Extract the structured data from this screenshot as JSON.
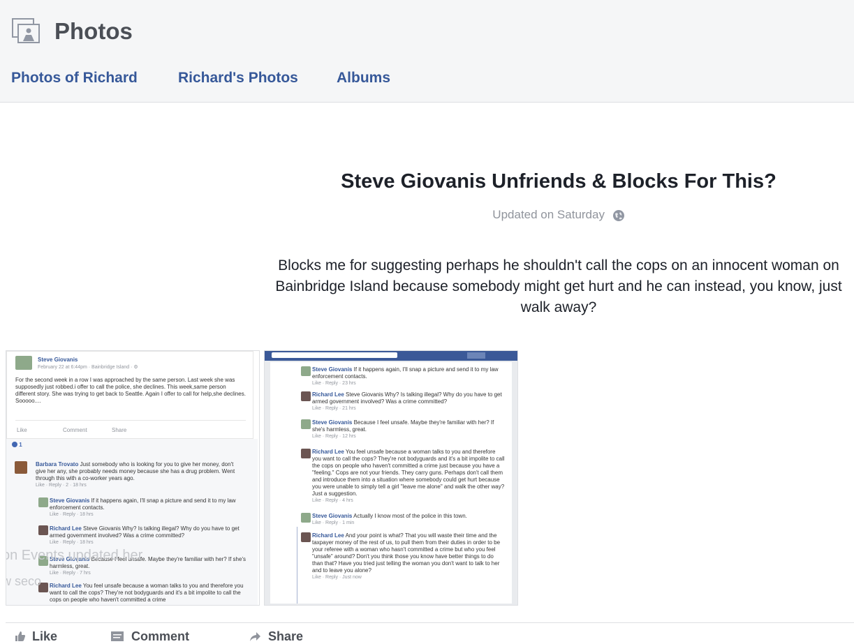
{
  "header": {
    "title": "Photos",
    "icon": "photos-icon",
    "tabs": [
      {
        "label": "Photos of Richard"
      },
      {
        "label": "Richard's Photos"
      },
      {
        "label": "Albums"
      }
    ]
  },
  "album": {
    "title": "Steve Giovanis Unfriends & Blocks For This?",
    "updated": "Updated on Saturday",
    "privacy_icon": "globe-icon",
    "description": "Blocks me for suggesting perhaps he shouldn't call the cops on an innocent woman on Bainbridge Island because somebody might get hurt and he can instead, you know, just walk away?"
  },
  "photo1": {
    "author": "Steve Giovanis",
    "meta": "February 22 at 6:44pm · Bainbridge Island · ⚙",
    "post_text": "For the second week in a row I was approached by the same person. Last week she was supposedly just robbed.i offer to call the police, she declines. This week,same person different story. She was trying to get back to Seattle. Again I offer to call for help,she declines. Sooooo....",
    "actions": [
      "Like",
      "Comment",
      "Share"
    ],
    "reaction_count": "1",
    "comments": [
      {
        "name": "Barbara Trovato",
        "text": "Just somebody who is looking for you to give her money, don't give her any, she probably needs money because she has a drug problem. Went through this with a co-worker years ago.",
        "meta": "Like · Reply · 2 · 18 hrs"
      },
      {
        "name": "Steve Giovanis",
        "text": "If it happens again, I'll snap a picture and send it to my law enforcement contacts.",
        "meta": "Like · Reply · 18 hrs"
      },
      {
        "name": "Richard Lee",
        "text": "Steve Giovanis Why? Is talking illegal? Why do you have to get armed government involved? Was a crime committed?",
        "meta": "Like · Reply · 18 hrs"
      },
      {
        "name": "Steve Giovanis",
        "text": "Because I feel unsafe. Maybe they're familiar with her? If she's harmless, great.",
        "meta": "Like · Reply · 7 hrs"
      },
      {
        "name": "Richard Lee",
        "text": "You feel unsafe because a woman talks to you and therefore you want to call the cops? They're not bodyguards and it's a bit impolite to call the cops on people who haven't committed a crime",
        "meta": ""
      }
    ],
    "ghost_text_1": "on Events updated her",
    "ghost_text_2": "w seco"
  },
  "photo2": {
    "comments": [
      {
        "name": "Steve Giovanis",
        "text": "If it happens again, I'll snap a picture and send it to my law enforcement contacts.",
        "meta": "Like · Reply · 23 hrs"
      },
      {
        "name": "Richard Lee",
        "text": "Steve Giovanis Why? Is talking illegal? Why do you have to get armed government involved? Was a crime committed?",
        "meta": "Like · Reply · 21 hrs"
      },
      {
        "name": "Steve Giovanis",
        "text": "Because I feel unsafe. Maybe they're familiar with her? If she's harmless, great.",
        "meta": "Like · Reply · 12 hrs"
      },
      {
        "name": "Richard Lee",
        "text": "You feel unsafe because a woman talks to you and therefore you want to call the cops? They're not bodyguards and it's a bit impolite to call the cops on people who haven't committed a crime just because you have a \"feeling.\" Cops are not your friends. They carry guns. Perhaps don't call them and introduce them into a situation where somebody could get hurt because you were unable to simply tell a girl \"leave me alone\" and walk the other way? Just a suggestion.",
        "meta": "Like · Reply · 4 hrs"
      },
      {
        "name": "Steve Giovanis",
        "text": "Actually I know most of the police in this town.",
        "meta": "Like · Reply · 1 min"
      },
      {
        "name": "Richard Lee",
        "text": "And your point is what? That you will waste their time and the taxpayer money of the rest of us, to pull them from their duties in order to be your referee with a woman who hasn't committed a crime but who you feel \"unsafe\" around? Don't you think those you know have better things to do than that? Have you tried just telling the woman you don't want to talk to her and to leave you alone?",
        "meta": "Like · Reply · Just now"
      }
    ]
  },
  "footer": {
    "actions": [
      {
        "label": "Like",
        "icon": "thumbs-up-icon"
      },
      {
        "label": "Comment",
        "icon": "comment-icon"
      },
      {
        "label": "Share",
        "icon": "share-icon"
      }
    ]
  }
}
